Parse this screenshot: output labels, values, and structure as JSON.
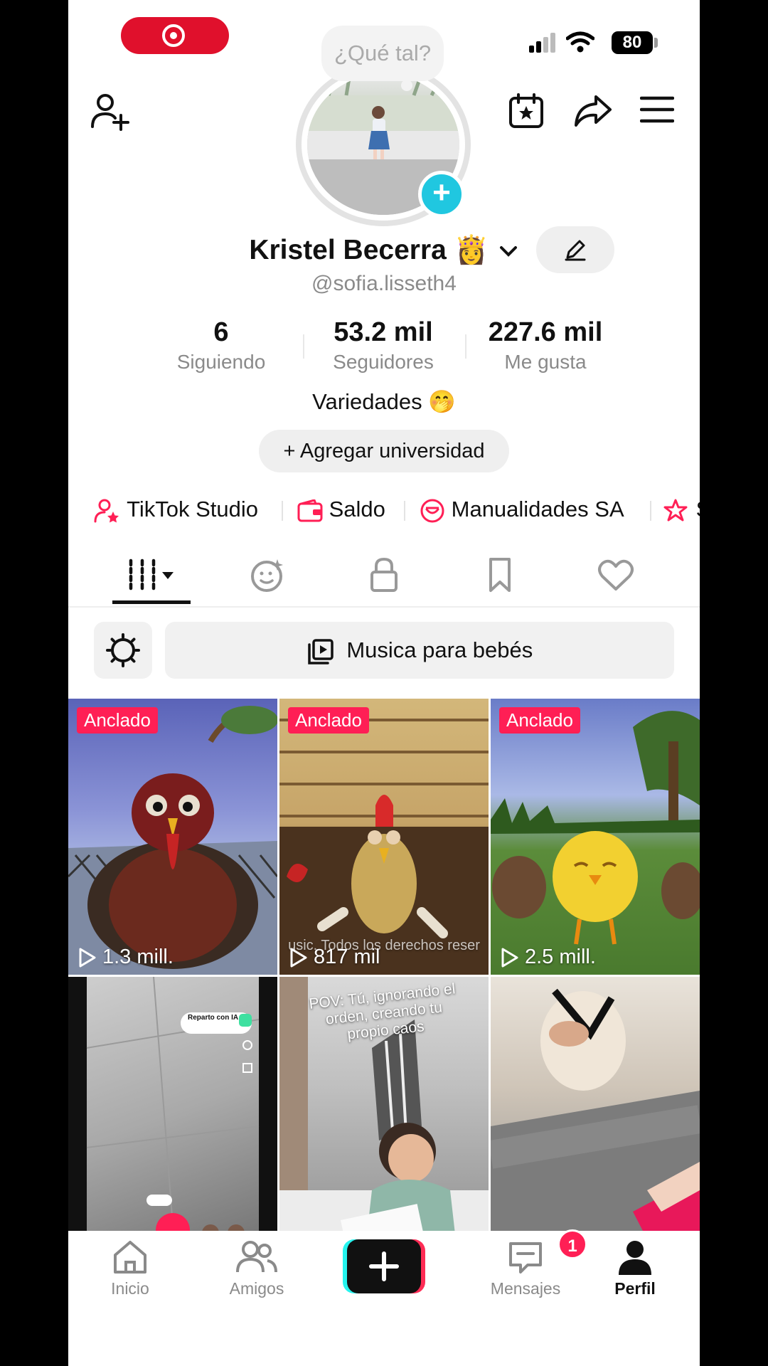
{
  "status_bar": {
    "battery": "80"
  },
  "profile": {
    "greeting_bubble": "¿Qué tal?",
    "display_name": "Kristel Becerra 👸",
    "username": "@sofia.lisseth4",
    "stats": [
      {
        "value": "6",
        "label": "Siguiendo"
      },
      {
        "value": "53.2 mil",
        "label": "Seguidores"
      },
      {
        "value": "227.6 mil",
        "label": "Me gusta"
      }
    ],
    "bio": "Variedades 🤭",
    "add_university": "+ Agregar universidad"
  },
  "shortcuts": [
    {
      "label": "TikTok Studio",
      "icon": "person-star-icon"
    },
    {
      "label": "Saldo",
      "icon": "wallet-icon"
    },
    {
      "label": "Manualidades SA",
      "icon": "shop-icon"
    },
    {
      "label": "S",
      "icon": "star-ribbon-icon"
    }
  ],
  "tabs": [
    "videos-grid-icon",
    "reposts-icon",
    "lock-icon",
    "bookmark-icon",
    "heart-icon"
  ],
  "playlist": {
    "label": "Musica para bebés"
  },
  "grid": [
    {
      "badge": "Anclado",
      "views": "1.3 mill."
    },
    {
      "badge": "Anclado",
      "views": "817 mil",
      "overlay": "usic. Todos los derechos reser"
    },
    {
      "badge": "Anclado",
      "views": "2.5 mill."
    },
    {
      "overlay": "Reparto con IA"
    },
    {
      "overlay": "POV: Tú, ignorando el orden, creando tu propio caos"
    },
    {}
  ],
  "bottom_nav": [
    {
      "label": "Inicio",
      "icon": "home-icon"
    },
    {
      "label": "Amigos",
      "icon": "friends-icon"
    },
    {
      "label": "",
      "icon": "create-plus-icon"
    },
    {
      "label": "Mensajes",
      "icon": "inbox-icon",
      "badge": "1"
    },
    {
      "label": "Perfil",
      "icon": "profile-icon"
    }
  ],
  "colors": {
    "accent": "#ff1f55",
    "cyan": "#20c7e0",
    "text": "#111111",
    "muted": "#8a8a8a"
  }
}
